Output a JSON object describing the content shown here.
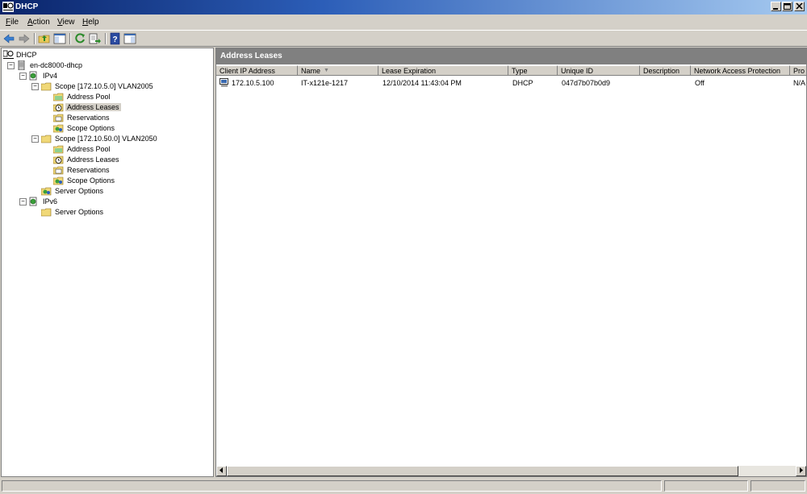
{
  "window": {
    "title": "DHCP"
  },
  "menu": [
    "File",
    "Action",
    "View",
    "Help"
  ],
  "toolbar": [
    "back-icon",
    "forward-icon",
    "up-folder-icon",
    "show-hide-tree-icon",
    "refresh-icon",
    "export-list-icon",
    "help-icon",
    "properties-icon"
  ],
  "tree": {
    "root": "DHCP",
    "server": "en-dc8000-dhcp",
    "ipv4": "IPv4",
    "scope1": {
      "label": "Scope [172.10.5.0] VLAN2005",
      "children": [
        "Address Pool",
        "Address Leases",
        "Reservations",
        "Scope Options"
      ]
    },
    "scope2": {
      "label": "Scope [172.10.50.0] VLAN2050",
      "children": [
        "Address Pool",
        "Address Leases",
        "Reservations",
        "Scope Options"
      ]
    },
    "ipv4_server_options": "Server Options",
    "ipv6": "IPv6",
    "ipv6_server_options": "Server Options"
  },
  "content": {
    "title": "Address Leases",
    "columns": [
      "Client IP Address",
      "Name",
      "Lease Expiration",
      "Type",
      "Unique ID",
      "Description",
      "Network Access Protection",
      "Pro"
    ],
    "sort_indicator": "▼",
    "rows": [
      [
        "172.10.5.100",
        "IT-x121e-1217",
        "12/10/2014 11:43:04 PM",
        "DHCP",
        "047d7b07b0d9",
        "",
        "Off",
        "N/A"
      ]
    ]
  },
  "colors": {
    "title_start": "#0a246a",
    "title_end": "#a6caf0",
    "panel_header": "#808080",
    "face": "#d4d0c8"
  }
}
